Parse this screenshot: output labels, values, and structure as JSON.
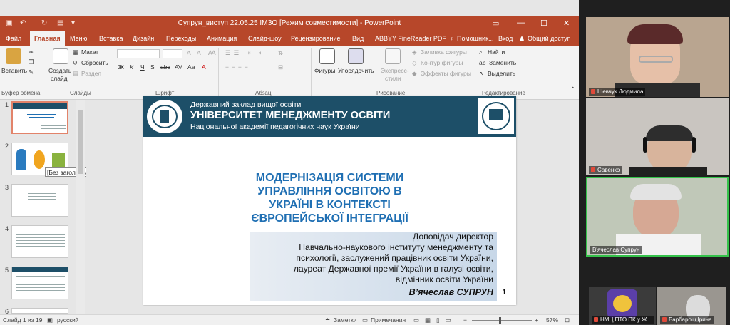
{
  "window": {
    "title": "Супрун_виступ 22.05.25 ІМЗО [Режим совместимости] - PowerPoint"
  },
  "tabs": [
    "Файл",
    "Главная",
    "Меню",
    "Вставка",
    "Дизайн",
    "Переходы",
    "Анимация",
    "Слайд-шоу",
    "Рецензирование",
    "Вид",
    "ABBYY FineReader PDF",
    "Помощник...",
    "Вход",
    "Общий доступ"
  ],
  "ribbon": {
    "paste": "Вставить",
    "create_slide_1": "Создать",
    "create_slide_2": "слайд",
    "layout": "Макет",
    "reset": "Сбросить",
    "section": "Раздел",
    "shapes": "Фигуры",
    "arrange": "Упорядочить",
    "express_1": "Экспресс-",
    "express_2": "стили",
    "fill": "Заливка фигуры",
    "outline": "Контур фигуры",
    "effects": "Эффекты фигуры",
    "find": "Найти",
    "replace": "Заменить",
    "select": "Выделить",
    "groups": {
      "clipboard": "Буфер обмена",
      "slides": "Слайды",
      "font": "Шрифт",
      "paragraph": "Абзац",
      "drawing": "Рисование",
      "editing": "Редактирование"
    },
    "font_buttons": [
      "Ж",
      "К",
      "Ч",
      "S",
      "abc",
      "AV",
      "Аа",
      "A"
    ]
  },
  "thumbs": {
    "numbers": [
      "1",
      "2",
      "3",
      "4",
      "5",
      "6"
    ],
    "tooltip": "[Без заголовка]"
  },
  "slide": {
    "banner_line1": "Державний заклад вищої освіти",
    "banner_line2": "УНІВЕРСИТЕТ МЕНЕДЖМЕНТУ ОСВІТИ",
    "banner_line3": "Національної академії педагогічних наук України",
    "title_lines": [
      "МОДЕРНІЗАЦІЯ СИСТЕМИ",
      "УПРАВЛІННЯ ОСВІТОЮ В",
      "УКРАЇНІ В КОНТЕКСТІ",
      "ЄВРОПЕЙСЬКОЇ ІНТЕГРАЦІЇ"
    ],
    "author_lines": [
      "Доповідач директор",
      "Навчально-наукового інституту менеджменту та",
      "психології, заслужений працівник освіти України,",
      "лауреат Державної премії України в галузі освіти,",
      "відмінник освіти України"
    ],
    "author_name": "В’ячеслав СУПРУН",
    "page_number": "1"
  },
  "status": {
    "slide": "Слайд 1 из 19",
    "lang": "русский",
    "notes": "Заметки",
    "comments": "Примечания",
    "zoom": "57%"
  },
  "participants": [
    "Шевчук Людмила",
    "Савенко",
    "В'ячеслав Супрун",
    "НМЦ ПТО ПК у Ж...",
    "Барбарош Ірина"
  ],
  "colors": {
    "accent": "#b7472a",
    "banner": "#1d4f68",
    "title": "#1f6fb3"
  }
}
